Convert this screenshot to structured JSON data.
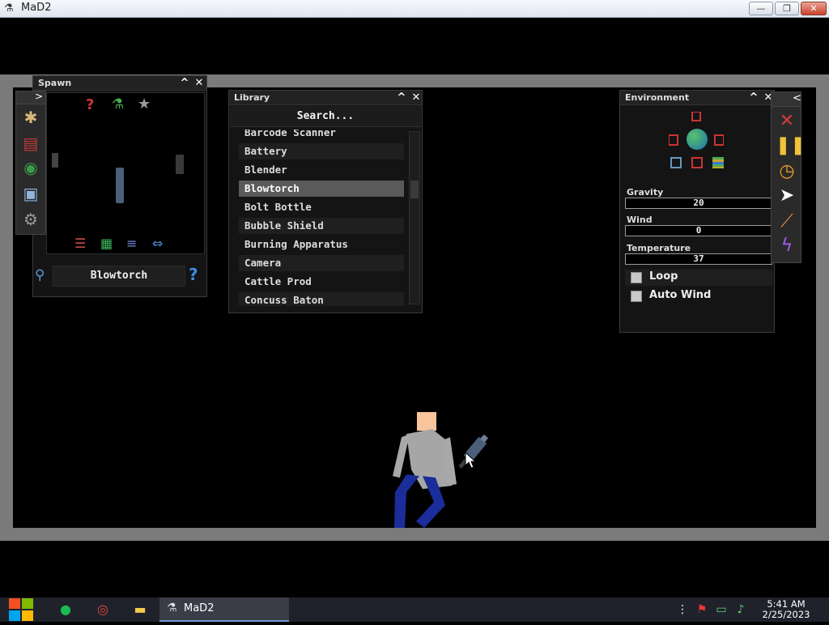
{
  "window": {
    "title": "MaD2",
    "icon": "mad2-app-icon",
    "minimize_glyph": "—",
    "maximize_glyph": "❐",
    "close_glyph": "✕"
  },
  "spawn": {
    "title": "Spawn",
    "collapse_glyph": "^",
    "close_glyph": "✕",
    "expand_glyph": ">",
    "side_tools": [
      "ragdoll-icon",
      "book-icon",
      "globe-icon",
      "save-icon",
      "gear-icon"
    ],
    "top_icons": [
      "question-red-icon",
      "flask-icon",
      "star-icon"
    ],
    "bottom_icons": [
      "sliders-icon",
      "grid-icon",
      "list-icon",
      "swap-arrows-icon"
    ],
    "search_icon": "magnifier-icon",
    "selected_item": "Blowtorch",
    "help_glyph": "?"
  },
  "library": {
    "title": "Library",
    "collapse_glyph": "^",
    "close_glyph": "✕",
    "search_placeholder": "Search...",
    "items": [
      "Barcode Scanner",
      "Battery",
      "Blender",
      "Blowtorch",
      "Bolt Bottle",
      "Bubble Shield",
      "Burning Apparatus",
      "Camera",
      "Cattle Prod",
      "Concuss Baton"
    ],
    "selected_index": 3
  },
  "environment": {
    "title": "Environment",
    "collapse_glyph": "^",
    "close_glyph": "✕",
    "gravity_label": "Gravity",
    "gravity_value": "20",
    "wind_label": "Wind",
    "wind_value": "0",
    "temperature_label": "Temperature",
    "temperature_value": "37",
    "loop_label": "Loop",
    "autowind_label": "Auto Wind",
    "loop_checked": false,
    "autowind_checked": false
  },
  "tool_rail": {
    "collapse_glyph": "<",
    "tools": [
      "delete-x-icon",
      "pause-icon",
      "stopwatch-icon",
      "cursor-icon",
      "knife-icon",
      "lightning-icon"
    ]
  },
  "taskbar": {
    "start_icon": "windows-start-icon",
    "pinned": [
      "spotify-icon",
      "chrome-icon",
      "folder-icon"
    ],
    "active_app": "MaD2",
    "time": "5:41 AM",
    "date": "2/25/2023",
    "tray": [
      "more-icon",
      "flag-icon",
      "network-icon",
      "volume-icon"
    ]
  },
  "colors": {
    "panel_bg": "#141414",
    "selected_row": "#5a5a5a",
    "frame": "#7a7a7a"
  }
}
